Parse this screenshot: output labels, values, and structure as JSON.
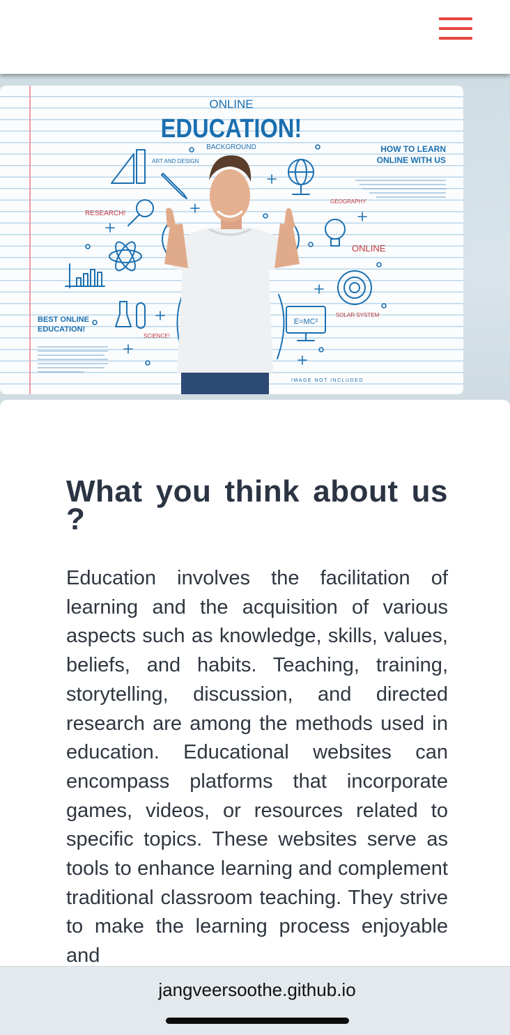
{
  "header": {
    "menu_icon": "hamburger-menu-icon",
    "accent_color": "#e8453c"
  },
  "hero": {
    "online_top": "ONLINE",
    "title": "EDUCATION!",
    "background_label": "BACKGROUND",
    "art_and_design": "ART AND DESIGN",
    "research": "RESEARCH!",
    "how_to_learn_1": "HOW TO LEARN",
    "how_to_learn_2": "ONLINE WITH US",
    "geography": "GEOGRAPHY",
    "online": "ONLINE",
    "solar_system": "SOLAR SYSTEM",
    "science": "SCIENCE!",
    "formula": "E=MC²",
    "best_online_1": "BEST ONLINE",
    "best_online_2": "EDUCATION!",
    "image_not_included": "IMAGE NOT INCLUDED",
    "line_color": "#1a6fb0"
  },
  "article": {
    "heading": "What you think about us ?",
    "body": "Education involves the facilitation of learning and the acquisition of various aspects such as knowledge, skills, values, beliefs, and habits. Teaching, training, storytelling, discussion, and directed research are among the methods used in education. Educational websites can encompass platforms that incorporate games, videos, or resources related to specific topics. These websites serve as tools to enhance learning and complement traditional classroom teaching. They strive to make the learning process enjoyable and"
  },
  "browser": {
    "url": "jangveersoothe.github.io"
  }
}
